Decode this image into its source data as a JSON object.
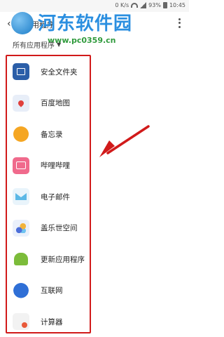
{
  "status_bar": {
    "net_speed": "0 K/s",
    "battery": "93%",
    "time": "10:45"
  },
  "watermark": {
    "title": "河东软件园",
    "url": "www.pc0359.cn"
  },
  "app_bar": {
    "title": "应用程序",
    "more_icon": "more-vert-icon"
  },
  "filter": {
    "label": "所有应用程序",
    "caret": "▼"
  },
  "apps": [
    {
      "label": "安全文件夹",
      "icon": "secure-folder-icon"
    },
    {
      "label": "百度地图",
      "icon": "baidu-map-icon"
    },
    {
      "label": "备忘录",
      "icon": "memo-icon"
    },
    {
      "label": "哔哩哔哩",
      "icon": "bilibili-icon"
    },
    {
      "label": "电子邮件",
      "icon": "email-icon"
    },
    {
      "label": "盖乐世空间",
      "icon": "galaxy-space-icon"
    },
    {
      "label": "更新应用程序",
      "icon": "android-update-icon"
    },
    {
      "label": "互联网",
      "icon": "internet-icon"
    },
    {
      "label": "计算器",
      "icon": "calculator-icon"
    }
  ],
  "colors": {
    "highlight_box": "#d11a1a",
    "arrow": "#d11a1a",
    "watermark_title": "#2b8fe0",
    "watermark_url": "#2f9a3c"
  }
}
